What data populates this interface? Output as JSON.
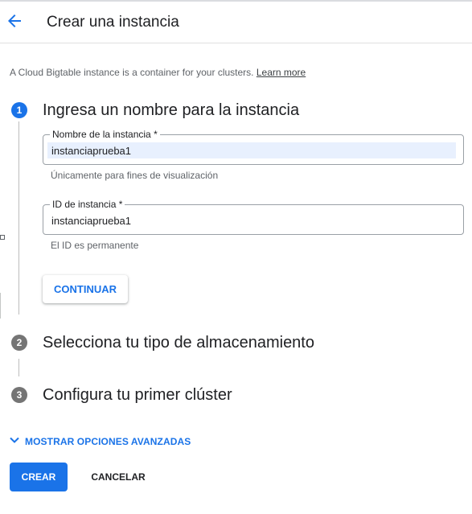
{
  "header": {
    "title": "Crear una instancia",
    "back_icon": "arrow-left-icon"
  },
  "intro": {
    "text": "A Cloud Bigtable instance is a container for your clusters.",
    "link": "Learn more"
  },
  "steps": [
    {
      "number": "1",
      "title": "Ingresa un nombre para la instancia",
      "state": "active",
      "fields": [
        {
          "label": "Nombre de la instancia *",
          "value": "instanciaprueba1",
          "hint": "Únicamente para fines de visualización"
        },
        {
          "label": "ID de instancia *",
          "value": "instanciaprueba1",
          "hint": "El ID es permanente"
        }
      ],
      "continue_label": "CONTINUAR"
    },
    {
      "number": "2",
      "title": "Selecciona tu tipo de almacenamiento",
      "state": "inactive"
    },
    {
      "number": "3",
      "title": "Configura tu primer clúster",
      "state": "inactive"
    }
  ],
  "advanced": {
    "label": "MOSTRAR OPCIONES AVANZADAS",
    "icon": "chevron-down-icon"
  },
  "actions": {
    "create": "CREAR",
    "cancel": "CANCELAR"
  },
  "colors": {
    "accent": "#1a73e8",
    "inactive_step": "#757575",
    "autofill_bg": "#e8f0fe"
  }
}
